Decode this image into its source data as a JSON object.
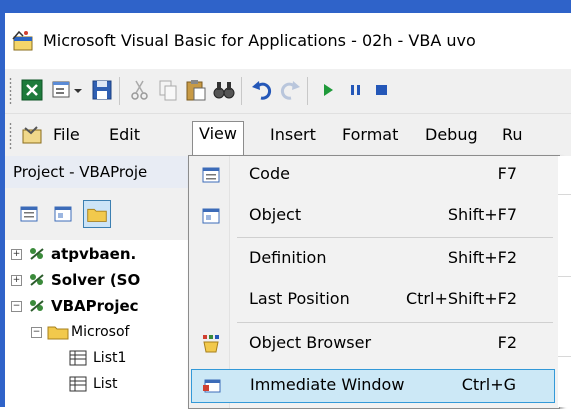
{
  "window": {
    "title": "Microsoft Visual Basic for Applications - 02h - VBA uvo"
  },
  "menubar": {
    "items": [
      "File",
      "Edit",
      "View",
      "Insert",
      "Format",
      "Debug",
      "Ru"
    ]
  },
  "project_panel": {
    "title": "Project - VBAProje",
    "tree": [
      {
        "label": "atpvbaen.",
        "bold": true,
        "expander": "+"
      },
      {
        "label": "Solver (SO",
        "bold": true,
        "expander": "+"
      },
      {
        "label": "VBAProjec",
        "bold": true,
        "expander": "−"
      },
      {
        "label": "Microsof",
        "bold": false,
        "expander": "−"
      },
      {
        "label": "List1",
        "bold": false,
        "expander": ""
      },
      {
        "label": "List",
        "bold": false,
        "expander": ""
      }
    ]
  },
  "view_menu": {
    "items": [
      {
        "label": "Code",
        "shortcut": "F7",
        "icon": "code-window-icon"
      },
      {
        "label": "Object",
        "shortcut": "Shift+F7",
        "icon": "object-icon"
      },
      {
        "label": "Definition",
        "shortcut": "Shift+F2",
        "icon": ""
      },
      {
        "label": "Last Position",
        "shortcut": "Ctrl+Shift+F2",
        "icon": ""
      },
      {
        "label": "Object Browser",
        "shortcut": "F2",
        "icon": "object-browser-icon"
      },
      {
        "label": "Immediate Window",
        "shortcut": "Ctrl+G",
        "icon": "immediate-window-icon",
        "highlighted": true
      }
    ]
  },
  "colors": {
    "frame": "#2f63c9",
    "highlight_bg": "#cce8f6",
    "highlight_border": "#3399d8"
  }
}
